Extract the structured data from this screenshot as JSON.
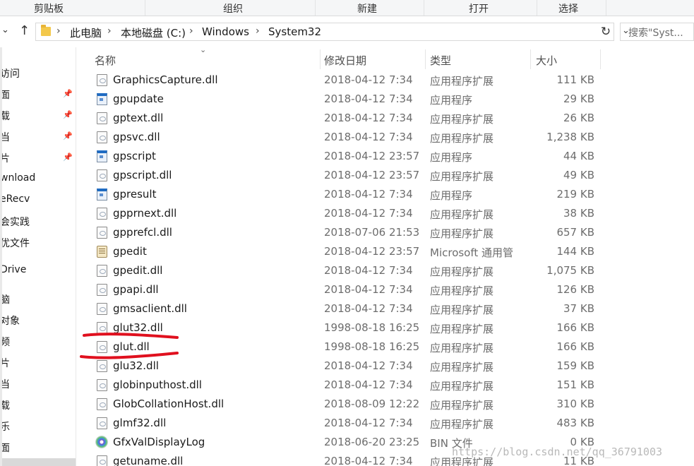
{
  "ribbon": {
    "groups": [
      "剪贴板",
      "组织",
      "新建",
      "打开",
      "选择"
    ]
  },
  "address": {
    "crumbs": [
      "此电脑",
      "本地磁盘 (C:)",
      "Windows",
      "System32"
    ],
    "search_placeholder": "搜索\"Syst..."
  },
  "nav": {
    "items": [
      "访问",
      "面",
      "载",
      "当",
      "片",
      "wnload",
      "eRecv",
      "会实践",
      "优文件",
      "Drive",
      "脑",
      "对象",
      "频",
      "片",
      "当",
      "载",
      "乐",
      "面"
    ]
  },
  "columns": {
    "name": "名称",
    "date": "修改日期",
    "type": "类型",
    "size": "大小"
  },
  "files": [
    {
      "name": "GraphicsCapture.dll",
      "date": "2018-04-12 7:34",
      "type": "应用程序扩展",
      "size": "111 KB",
      "icon": "dll"
    },
    {
      "name": "gpupdate",
      "date": "2018-04-12 7:34",
      "type": "应用程序",
      "size": "29 KB",
      "icon": "exe"
    },
    {
      "name": "gptext.dll",
      "date": "2018-04-12 7:34",
      "type": "应用程序扩展",
      "size": "26 KB",
      "icon": "dll"
    },
    {
      "name": "gpsvc.dll",
      "date": "2018-04-12 7:34",
      "type": "应用程序扩展",
      "size": "1,238 KB",
      "icon": "dll"
    },
    {
      "name": "gpscript",
      "date": "2018-04-12 23:57",
      "type": "应用程序",
      "size": "44 KB",
      "icon": "exe"
    },
    {
      "name": "gpscript.dll",
      "date": "2018-04-12 23:57",
      "type": "应用程序扩展",
      "size": "49 KB",
      "icon": "dll"
    },
    {
      "name": "gpresult",
      "date": "2018-04-12 7:34",
      "type": "应用程序",
      "size": "219 KB",
      "icon": "exe"
    },
    {
      "name": "gpprnext.dll",
      "date": "2018-04-12 7:34",
      "type": "应用程序扩展",
      "size": "38 KB",
      "icon": "dll"
    },
    {
      "name": "gpprefcl.dll",
      "date": "2018-07-06 21:53",
      "type": "应用程序扩展",
      "size": "657 KB",
      "icon": "dll"
    },
    {
      "name": "gpedit",
      "date": "2018-04-12 23:57",
      "type": "Microsoft 通用管",
      "size": "144 KB",
      "icon": "msc"
    },
    {
      "name": "gpedit.dll",
      "date": "2018-04-12 7:34",
      "type": "应用程序扩展",
      "size": "1,075 KB",
      "icon": "dll"
    },
    {
      "name": "gpapi.dll",
      "date": "2018-04-12 7:34",
      "type": "应用程序扩展",
      "size": "126 KB",
      "icon": "dll"
    },
    {
      "name": "gmsaclient.dll",
      "date": "2018-04-12 7:34",
      "type": "应用程序扩展",
      "size": "37 KB",
      "icon": "dll"
    },
    {
      "name": "glut32.dll",
      "date": "1998-08-18 16:25",
      "type": "应用程序扩展",
      "size": "166 KB",
      "icon": "dll"
    },
    {
      "name": "glut.dll",
      "date": "1998-08-18 16:25",
      "type": "应用程序扩展",
      "size": "166 KB",
      "icon": "dll"
    },
    {
      "name": "glu32.dll",
      "date": "2018-04-12 7:34",
      "type": "应用程序扩展",
      "size": "159 KB",
      "icon": "dll"
    },
    {
      "name": "globinputhost.dll",
      "date": "2018-04-12 7:34",
      "type": "应用程序扩展",
      "size": "151 KB",
      "icon": "dll"
    },
    {
      "name": "GlobCollationHost.dll",
      "date": "2018-08-09 12:22",
      "type": "应用程序扩展",
      "size": "310 KB",
      "icon": "dll"
    },
    {
      "name": "glmf32.dll",
      "date": "2018-04-12 7:34",
      "type": "应用程序扩展",
      "size": "483 KB",
      "icon": "dll"
    },
    {
      "name": "GfxValDisplayLog",
      "date": "2018-06-20 23:25",
      "type": "BIN 文件",
      "size": "0 KB",
      "icon": "bin"
    },
    {
      "name": "getuname.dll",
      "date": "2018-04-12 7:34",
      "type": "应用程序扩展",
      "size": "11 KB",
      "icon": "dll"
    }
  ],
  "watermark": "https://blog.csdn.net/qq_36791003",
  "colors": {
    "annotation_red": "#e0101e",
    "folder_yellow": "#f3c84b"
  }
}
